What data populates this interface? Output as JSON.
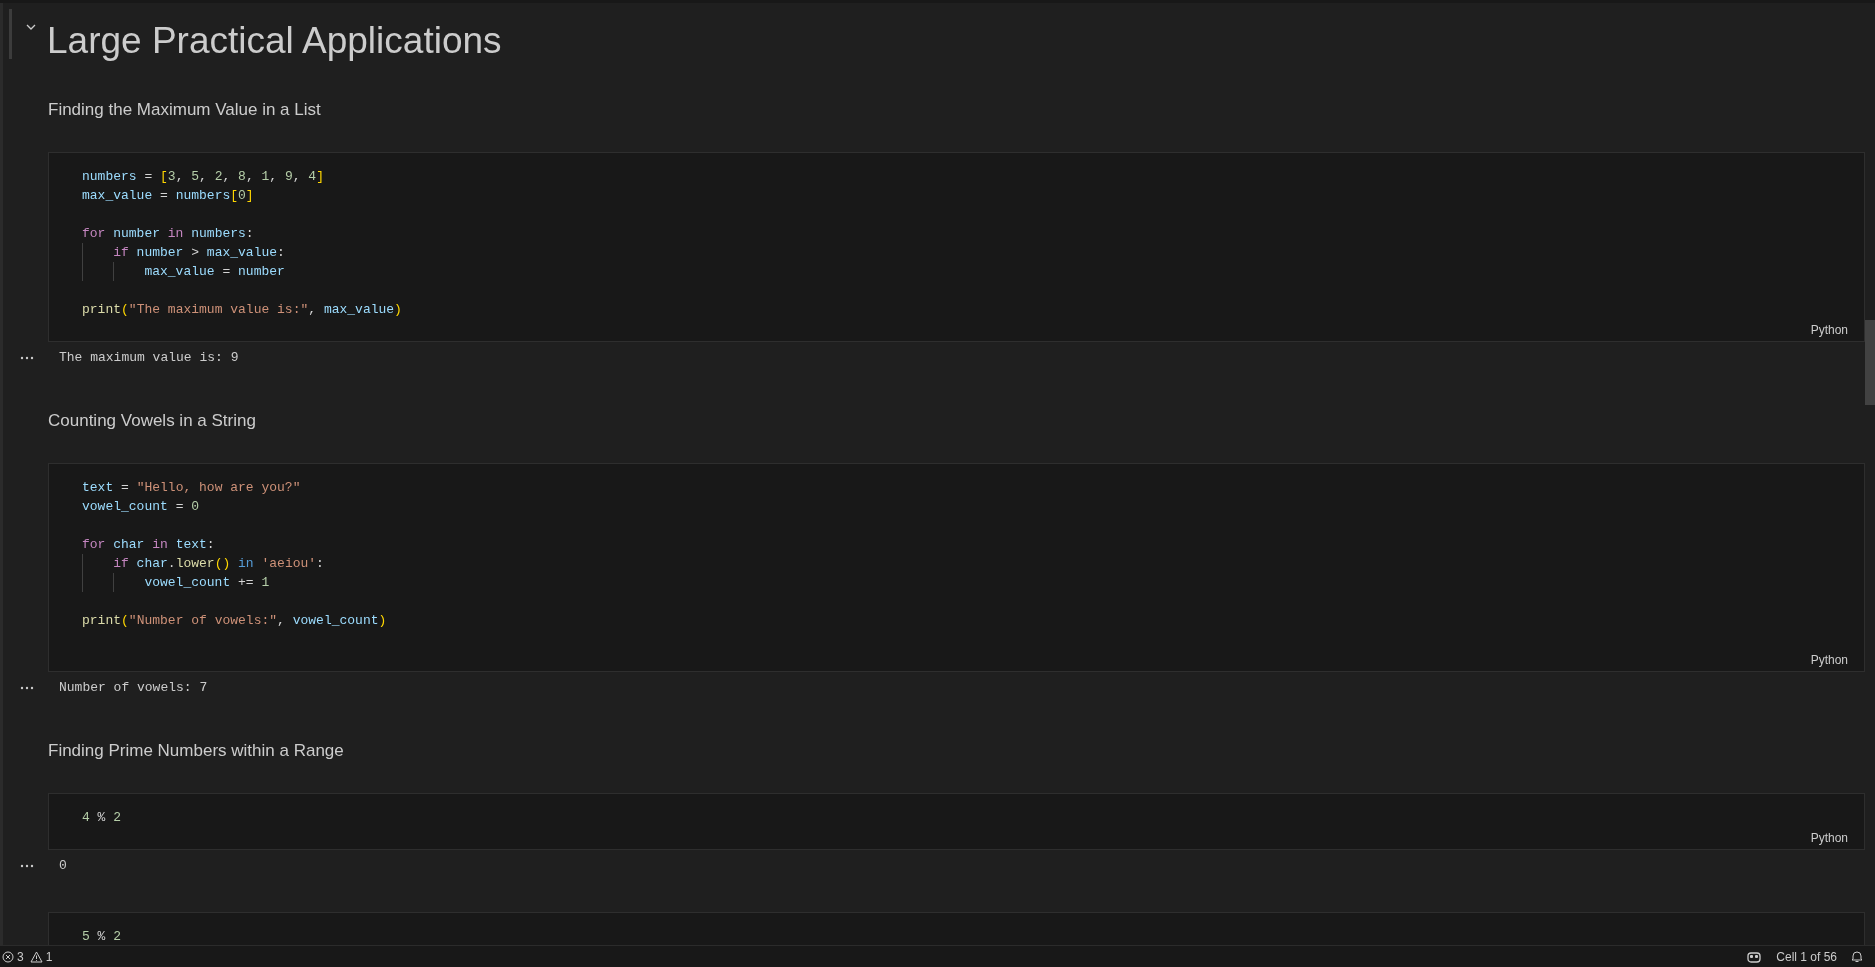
{
  "heading": {
    "text": "Large Practical Applications",
    "expanded": true
  },
  "cells": [
    {
      "kind": "markdown",
      "text": "Finding the Maximum Value in a List"
    },
    {
      "kind": "code",
      "language": "Python",
      "output": "The maximum value is: 9",
      "lines": [
        {
          "kind": "code",
          "tokens": [
            {
              "kind": "var",
              "text": "numbers"
            },
            {
              "kind": "plain",
              "text": " = "
            },
            {
              "kind": "bracket",
              "text": "["
            },
            {
              "kind": "num",
              "text": "3"
            },
            {
              "kind": "plain",
              "text": ", "
            },
            {
              "kind": "num",
              "text": "5"
            },
            {
              "kind": "plain",
              "text": ", "
            },
            {
              "kind": "num",
              "text": "2"
            },
            {
              "kind": "plain",
              "text": ", "
            },
            {
              "kind": "num",
              "text": "8"
            },
            {
              "kind": "plain",
              "text": ", "
            },
            {
              "kind": "num",
              "text": "1"
            },
            {
              "kind": "plain",
              "text": ", "
            },
            {
              "kind": "num",
              "text": "9"
            },
            {
              "kind": "plain",
              "text": ", "
            },
            {
              "kind": "num",
              "text": "4"
            },
            {
              "kind": "bracket",
              "text": "]"
            }
          ]
        },
        {
          "kind": "code",
          "tokens": [
            {
              "kind": "var",
              "text": "max_value"
            },
            {
              "kind": "plain",
              "text": " = "
            },
            {
              "kind": "var",
              "text": "numbers"
            },
            {
              "kind": "bracket",
              "text": "["
            },
            {
              "kind": "num",
              "text": "0"
            },
            {
              "kind": "bracket",
              "text": "]"
            }
          ]
        },
        {
          "kind": "blank"
        },
        {
          "kind": "code",
          "tokens": [
            {
              "kind": "control",
              "text": "for"
            },
            {
              "kind": "var",
              "text": " number"
            },
            {
              "kind": "control",
              "text": " in"
            },
            {
              "kind": "var",
              "text": " numbers"
            },
            {
              "kind": "plain",
              "text": ":"
            }
          ]
        },
        {
          "kind": "code",
          "tokens": [
            {
              "kind": "control",
              "text": "    if"
            },
            {
              "kind": "var",
              "text": " number"
            },
            {
              "kind": "plain",
              "text": " > "
            },
            {
              "kind": "var",
              "text": "max_value"
            },
            {
              "kind": "plain",
              "text": ":"
            }
          ]
        },
        {
          "kind": "code",
          "tokens": [
            {
              "kind": "var",
              "text": "        max_value"
            },
            {
              "kind": "plain",
              "text": " = "
            },
            {
              "kind": "var",
              "text": "number"
            }
          ]
        },
        {
          "kind": "blank"
        },
        {
          "kind": "code",
          "tokens": [
            {
              "kind": "func",
              "text": "print"
            },
            {
              "kind": "bracket",
              "text": "("
            },
            {
              "kind": "str",
              "text": "\"The maximum value is:\""
            },
            {
              "kind": "plain",
              "text": ", "
            },
            {
              "kind": "var",
              "text": "max_value"
            },
            {
              "kind": "bracket",
              "text": ")"
            }
          ]
        }
      ]
    },
    {
      "kind": "markdown",
      "text": "Counting Vowels in a String"
    },
    {
      "kind": "code",
      "language": "Python",
      "output": "Number of vowels: 7",
      "lines": [
        {
          "kind": "code",
          "tokens": [
            {
              "kind": "var",
              "text": "text"
            },
            {
              "kind": "plain",
              "text": " = "
            },
            {
              "kind": "str",
              "text": "\"Hello, how are you?\""
            }
          ]
        },
        {
          "kind": "code",
          "tokens": [
            {
              "kind": "var",
              "text": "vowel_count"
            },
            {
              "kind": "plain",
              "text": " = "
            },
            {
              "kind": "num",
              "text": "0"
            }
          ]
        },
        {
          "kind": "blank"
        },
        {
          "kind": "code",
          "tokens": [
            {
              "kind": "control",
              "text": "for"
            },
            {
              "kind": "var",
              "text": " char"
            },
            {
              "kind": "control",
              "text": " in"
            },
            {
              "kind": "var",
              "text": " text"
            },
            {
              "kind": "plain",
              "text": ":"
            }
          ]
        },
        {
          "kind": "code",
          "tokens": [
            {
              "kind": "control",
              "text": "    if"
            },
            {
              "kind": "var",
              "text": " char"
            },
            {
              "kind": "plain",
              "text": "."
            },
            {
              "kind": "func",
              "text": "lower"
            },
            {
              "kind": "bracket",
              "text": "()"
            },
            {
              "kind": "op",
              "text": " in"
            },
            {
              "kind": "str",
              "text": " 'aeiou'"
            },
            {
              "kind": "plain",
              "text": ":"
            }
          ]
        },
        {
          "kind": "code",
          "tokens": [
            {
              "kind": "var",
              "text": "        vowel_count"
            },
            {
              "kind": "plain",
              "text": " += "
            },
            {
              "kind": "num",
              "text": "1"
            }
          ]
        },
        {
          "kind": "blank"
        },
        {
          "kind": "code",
          "tokens": [
            {
              "kind": "func",
              "text": "print"
            },
            {
              "kind": "bracket",
              "text": "("
            },
            {
              "kind": "str",
              "text": "\"Number of vowels:\""
            },
            {
              "kind": "plain",
              "text": ", "
            },
            {
              "kind": "var",
              "text": "vowel_count"
            },
            {
              "kind": "bracket",
              "text": ")"
            }
          ]
        },
        {
          "kind": "blank"
        }
      ]
    },
    {
      "kind": "markdown",
      "text": "Finding Prime Numbers within a Range"
    },
    {
      "kind": "code",
      "language": "Python",
      "output": "0",
      "lines": [
        {
          "kind": "code",
          "tokens": [
            {
              "kind": "num",
              "text": "4"
            },
            {
              "kind": "plain",
              "text": " % "
            },
            {
              "kind": "num",
              "text": "2"
            }
          ]
        }
      ]
    },
    {
      "kind": "code",
      "lines": [
        {
          "kind": "code",
          "tokens": [
            {
              "kind": "num",
              "text": "5"
            },
            {
              "kind": "plain",
              "text": " % "
            },
            {
              "kind": "num",
              "text": "2"
            }
          ]
        }
      ]
    }
  ],
  "status_bar": {
    "errors": "3",
    "warnings": "1",
    "cell_position": "Cell 1 of 56"
  }
}
